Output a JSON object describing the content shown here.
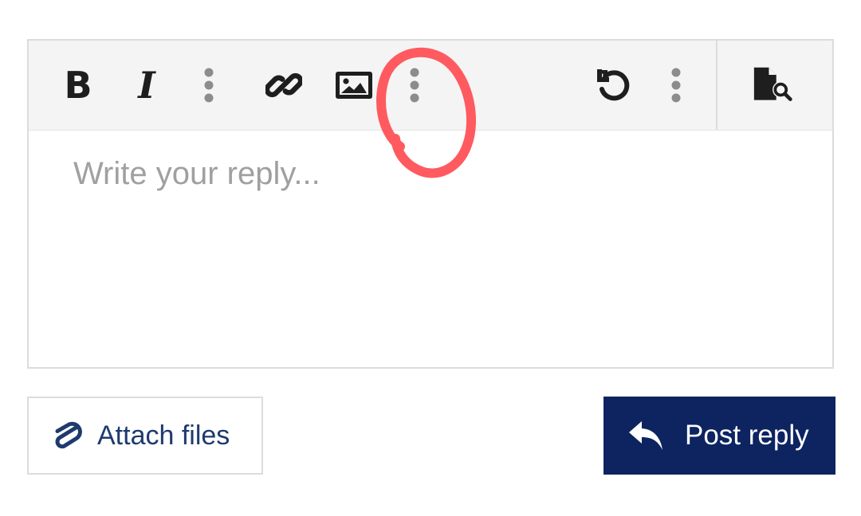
{
  "toolbar": {
    "bold_label": "B",
    "italic_label": "I",
    "buttons": [
      "bold-icon",
      "italic-icon",
      "more-vertical-icon",
      "link-icon",
      "image-icon",
      "more-vertical-icon",
      "undo-icon",
      "more-vertical-icon",
      "preview-icon"
    ]
  },
  "editor": {
    "placeholder": "Write your reply..."
  },
  "actions": {
    "attach_label": "Attach files",
    "post_label": "Post reply"
  },
  "colors": {
    "toolbar_bg": "#f4f4f4",
    "primary": "#0d2461",
    "attach_text": "#1e3a6e",
    "icon": "#1e1e1e",
    "more_dots": "#8c8c8c",
    "annotation": "#ff5a5f"
  }
}
